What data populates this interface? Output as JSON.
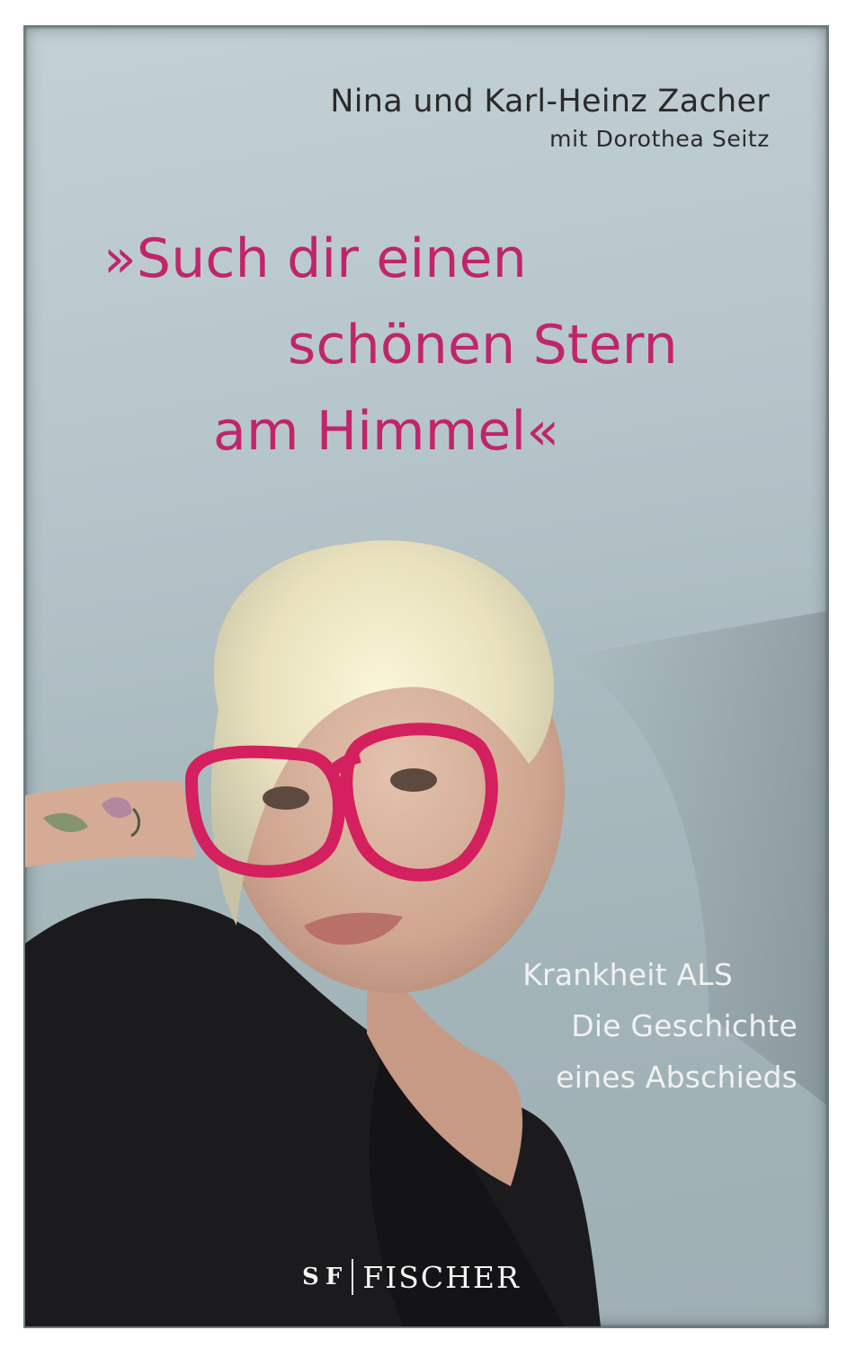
{
  "cover": {
    "authors": "Nina und Karl-Heinz Zacher",
    "coauthor": "mit Dorothea Seitz",
    "title_lines": [
      "»Such dir einen",
      "schönen Stern",
      "am Himmel«"
    ],
    "subtitle_lines": [
      "Krankheit ALS",
      "Die Geschichte",
      "eines Abschieds"
    ],
    "publisher": {
      "logo_text": "S F",
      "name": "FISCHER"
    }
  },
  "colors": {
    "title": "#c0256c",
    "background": "#b7c6cb",
    "glasses": "#d4205e"
  },
  "icons": {
    "publisher_logo": "fischer-fs-logo-icon"
  }
}
